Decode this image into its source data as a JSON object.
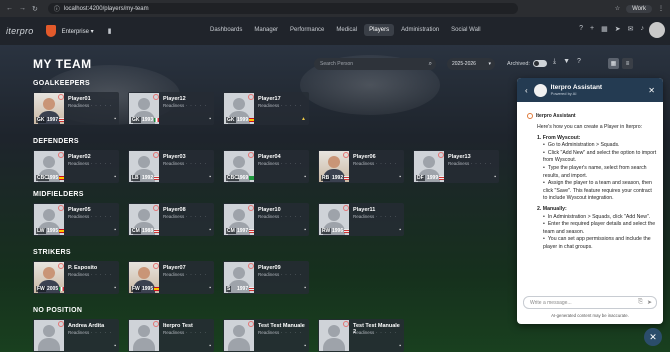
{
  "browser": {
    "url": "localhost:4200/players/my-team",
    "profile": "Work"
  },
  "app": {
    "logo": "iterpro",
    "org": "Enterprise",
    "menu": [
      "Dashboards",
      "Manager",
      "Performance",
      "Medical",
      "Players",
      "Administration",
      "Social Wall"
    ],
    "active_menu": "Players"
  },
  "page": {
    "title": "MY TEAM",
    "search_placeholder": "Search Person",
    "season": "2025-2026",
    "archived_label": "Archived:"
  },
  "sections": [
    {
      "name": "GOALKEEPERS",
      "players": [
        {
          "name": "Player01",
          "pos": "GK",
          "year": "1997",
          "flag": "en",
          "real": true
        },
        {
          "name": "Player12",
          "pos": "GK",
          "year": "1993",
          "flag": "it",
          "real": false
        },
        {
          "name": "Player17",
          "pos": "GK",
          "year": "1999",
          "flag": "es",
          "real": false,
          "warn": true
        }
      ]
    },
    {
      "name": "DEFENDERS",
      "players": [
        {
          "name": "Player02",
          "pos": "CBC",
          "year": "1995",
          "flag": "es",
          "real": false
        },
        {
          "name": "Player03",
          "pos": "LB",
          "year": "1992",
          "flag": "en",
          "real": false
        },
        {
          "name": "Player04",
          "pos": "CBC",
          "year": "1969",
          "flag": "br",
          "real": false
        },
        {
          "name": "Player06",
          "pos": "RB",
          "year": "1992",
          "flag": "en",
          "real": true
        },
        {
          "name": "Player13",
          "pos": "DF",
          "year": "1999",
          "flag": "en",
          "real": false
        }
      ]
    },
    {
      "name": "MIDFIELDERS",
      "players": [
        {
          "name": "Player05",
          "pos": "LW",
          "year": "1995",
          "flag": "es",
          "real": false
        },
        {
          "name": "Player08",
          "pos": "CM",
          "year": "1988",
          "flag": "en",
          "real": false
        },
        {
          "name": "Player10",
          "pos": "CM",
          "year": "1997",
          "flag": "en",
          "real": false
        },
        {
          "name": "Player11",
          "pos": "RW",
          "year": "1996",
          "flag": "en",
          "real": false
        }
      ]
    },
    {
      "name": "STRIKERS",
      "players": [
        {
          "name": "P. Esposito",
          "pos": "FW",
          "year": "2005",
          "flag": "it",
          "real": true
        },
        {
          "name": "Player07",
          "pos": "FW",
          "year": "1995",
          "flag": "es",
          "real": true
        },
        {
          "name": "Player09",
          "pos": "S",
          "year": "1997",
          "flag": "en",
          "real": false
        }
      ]
    },
    {
      "name": "NO POSITION",
      "players": [
        {
          "name": "Andrea Ardita",
          "pos": "",
          "year": "",
          "flag": "",
          "real": false
        },
        {
          "name": "Iterpro Test",
          "pos": "",
          "year": "",
          "flag": "",
          "real": false
        },
        {
          "name": "Test Test Manuale",
          "pos": "",
          "year": "",
          "flag": "",
          "real": false
        },
        {
          "name": "Test Test Manuale 2",
          "pos": "",
          "year": "",
          "flag": "",
          "real": false
        }
      ]
    }
  ],
  "readiness_label": "Readiness",
  "assistant": {
    "title": "Iterpro Assistant",
    "subtitle": "Powered by AI",
    "sender": "Iterpro Assistant",
    "intro": "Here's how you can create a Player in Iterpro:",
    "s1": "1. From Wyscout:",
    "s1_items": [
      "Go to Administration > Squads.",
      "Click \"Add New\" and select the option to import from Wyscout.",
      "Type the player's name, select from search results, and import.",
      "Assign the player to a team and season, then click \"Save\". This feature requires your contract to include Wyscout integration."
    ],
    "s2": "2. Manually:",
    "s2_items": [
      "In Administration > Squads, click \"Add New\".",
      "Enter the required player details and select the team and season.",
      "You can set app permissions and include the player in chat groups."
    ],
    "input_placeholder": "Write a message...",
    "disclaimer": "AI-generated content may be inaccurate."
  }
}
